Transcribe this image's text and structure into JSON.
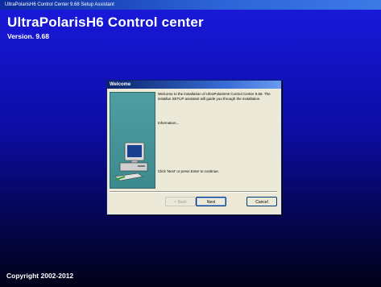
{
  "window": {
    "title": "UltraPolarisH6 Control Center 9.68 Setup Assistant"
  },
  "header": {
    "app_title": "UltraPolarisH6 Control center",
    "version": "Version. 9.68"
  },
  "footer": {
    "copyright": "Copyright 2002-2012"
  },
  "dialog": {
    "title": "Welcome",
    "welcome_text": "Welcome to the installation of UltraPolarisH6 Control Center 9.68. The installus SETUP assistant will guide you through the installation.",
    "information_label": "Information...",
    "instruction_text": "Click 'Next' or press Enter to continue.",
    "buttons": {
      "back": "< Back",
      "next": "Next",
      "cancel": "Cancel"
    }
  },
  "colors": {
    "desktop_top": "#1a1adc",
    "desktop_bottom": "#010118",
    "dialog_face": "#ece9d8",
    "side_panel": "#4f9ea2"
  },
  "icons": {
    "side_panel_image": "computer-icon"
  }
}
